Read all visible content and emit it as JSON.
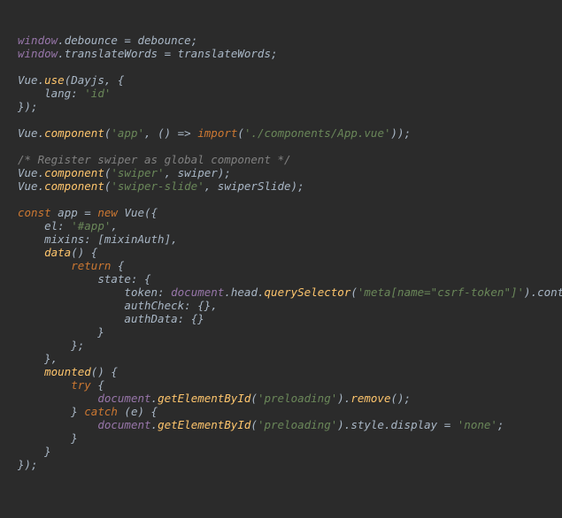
{
  "line1": {
    "window": "window",
    "dot": ".",
    "debounce": "debounce",
    "eq": " = ",
    "debounce2": "debounce",
    "semi": ";"
  },
  "line2": {
    "window": "window",
    "dot": ".",
    "translateWords": "translateWords",
    "eq": " = ",
    "tw2": "translateWords",
    "semi": ";"
  },
  "line4": {
    "Vue": "Vue",
    "dot": ".",
    "use": "use",
    "open": "(",
    "Dayjs": "Dayjs",
    "comma": ", {"
  },
  "line5": {
    "indent": "    ",
    "lang": "lang",
    "colon": ": ",
    "id": "'id'"
  },
  "line6": {
    "close": "});"
  },
  "line8": {
    "Vue": "Vue",
    "dot": ".",
    "component": "component",
    "open": "(",
    "app": "'app'",
    "sep": ", () ",
    "arrow": "=>",
    "sp": " ",
    "import": "import",
    "open2": "(",
    "path": "'./components/App.vue'",
    "close": "));"
  },
  "line10": {
    "cmt": "/* Register swiper as global component */"
  },
  "line11": {
    "Vue": "Vue",
    "dot": ".",
    "component": "component",
    "open": "(",
    "s": "'swiper'",
    "sep": ", ",
    "sw": "swiper",
    "close": ");"
  },
  "line12": {
    "Vue": "Vue",
    "dot": ".",
    "component": "component",
    "open": "(",
    "s": "'swiper-slide'",
    "sep": ", ",
    "sw": "swiperSlide",
    "close": ");"
  },
  "line14": {
    "const": "const",
    "sp": " ",
    "app": "app",
    "eq": " = ",
    "new": "new",
    "sp2": " ",
    "Vue": "Vue",
    "open": "({"
  },
  "line15": {
    "indent": "    ",
    "el": "el",
    "colon": ": ",
    "v": "'#app'",
    "comma": ","
  },
  "line16": {
    "indent": "    ",
    "mixins": "mixins",
    "colon": ": [",
    "v": "mixinAuth",
    "close": "],"
  },
  "line17": {
    "indent": "    ",
    "data": "data",
    "paren": "() {"
  },
  "line18": {
    "indent": "        ",
    "return": "return",
    "brace": " {"
  },
  "line19": {
    "indent": "            ",
    "state": "state",
    "colon": ": {"
  },
  "line20": {
    "indent": "                ",
    "token": "token",
    "colon": ": ",
    "doc": "document",
    "d1": ".",
    "head": "head",
    "d2": ".",
    "qs": "querySelector",
    "open": "(",
    "sel": "'meta[name=\"csrf-token\"]'",
    "close": ").",
    "content": "content",
    "comma": ","
  },
  "line21": {
    "indent": "                ",
    "authCheck": "authCheck",
    "v": ": {},"
  },
  "line22": {
    "indent": "                ",
    "authData": "authData",
    "v": ": {}"
  },
  "line23": {
    "indent": "            }"
  },
  "line24": {
    "indent": "        };"
  },
  "line25": {
    "indent": "    },"
  },
  "line26": {
    "indent": "    ",
    "mounted": "mounted",
    "paren": "() {"
  },
  "line27": {
    "indent": "        ",
    "try": "try",
    "brace": " {"
  },
  "line28": {
    "indent": "            ",
    "doc": "document",
    "d": ".",
    "get": "getElementById",
    "open": "(",
    "s": "'preloading'",
    "close": ").",
    "remove": "remove",
    "end": "();"
  },
  "line29": {
    "indent": "        } ",
    "catch": "catch",
    "e": " (e) {"
  },
  "line30": {
    "indent": "            ",
    "doc": "document",
    "d": ".",
    "get": "getElementById",
    "open": "(",
    "s": "'preloading'",
    "close": ").",
    "style": "style",
    "d2": ".",
    "display": "display",
    "eq": " = ",
    "none": "'none'",
    "semi": ";"
  },
  "line31": {
    "indent": "        }"
  },
  "line32": {
    "indent": "    }"
  },
  "line33": {
    "close": "});"
  }
}
